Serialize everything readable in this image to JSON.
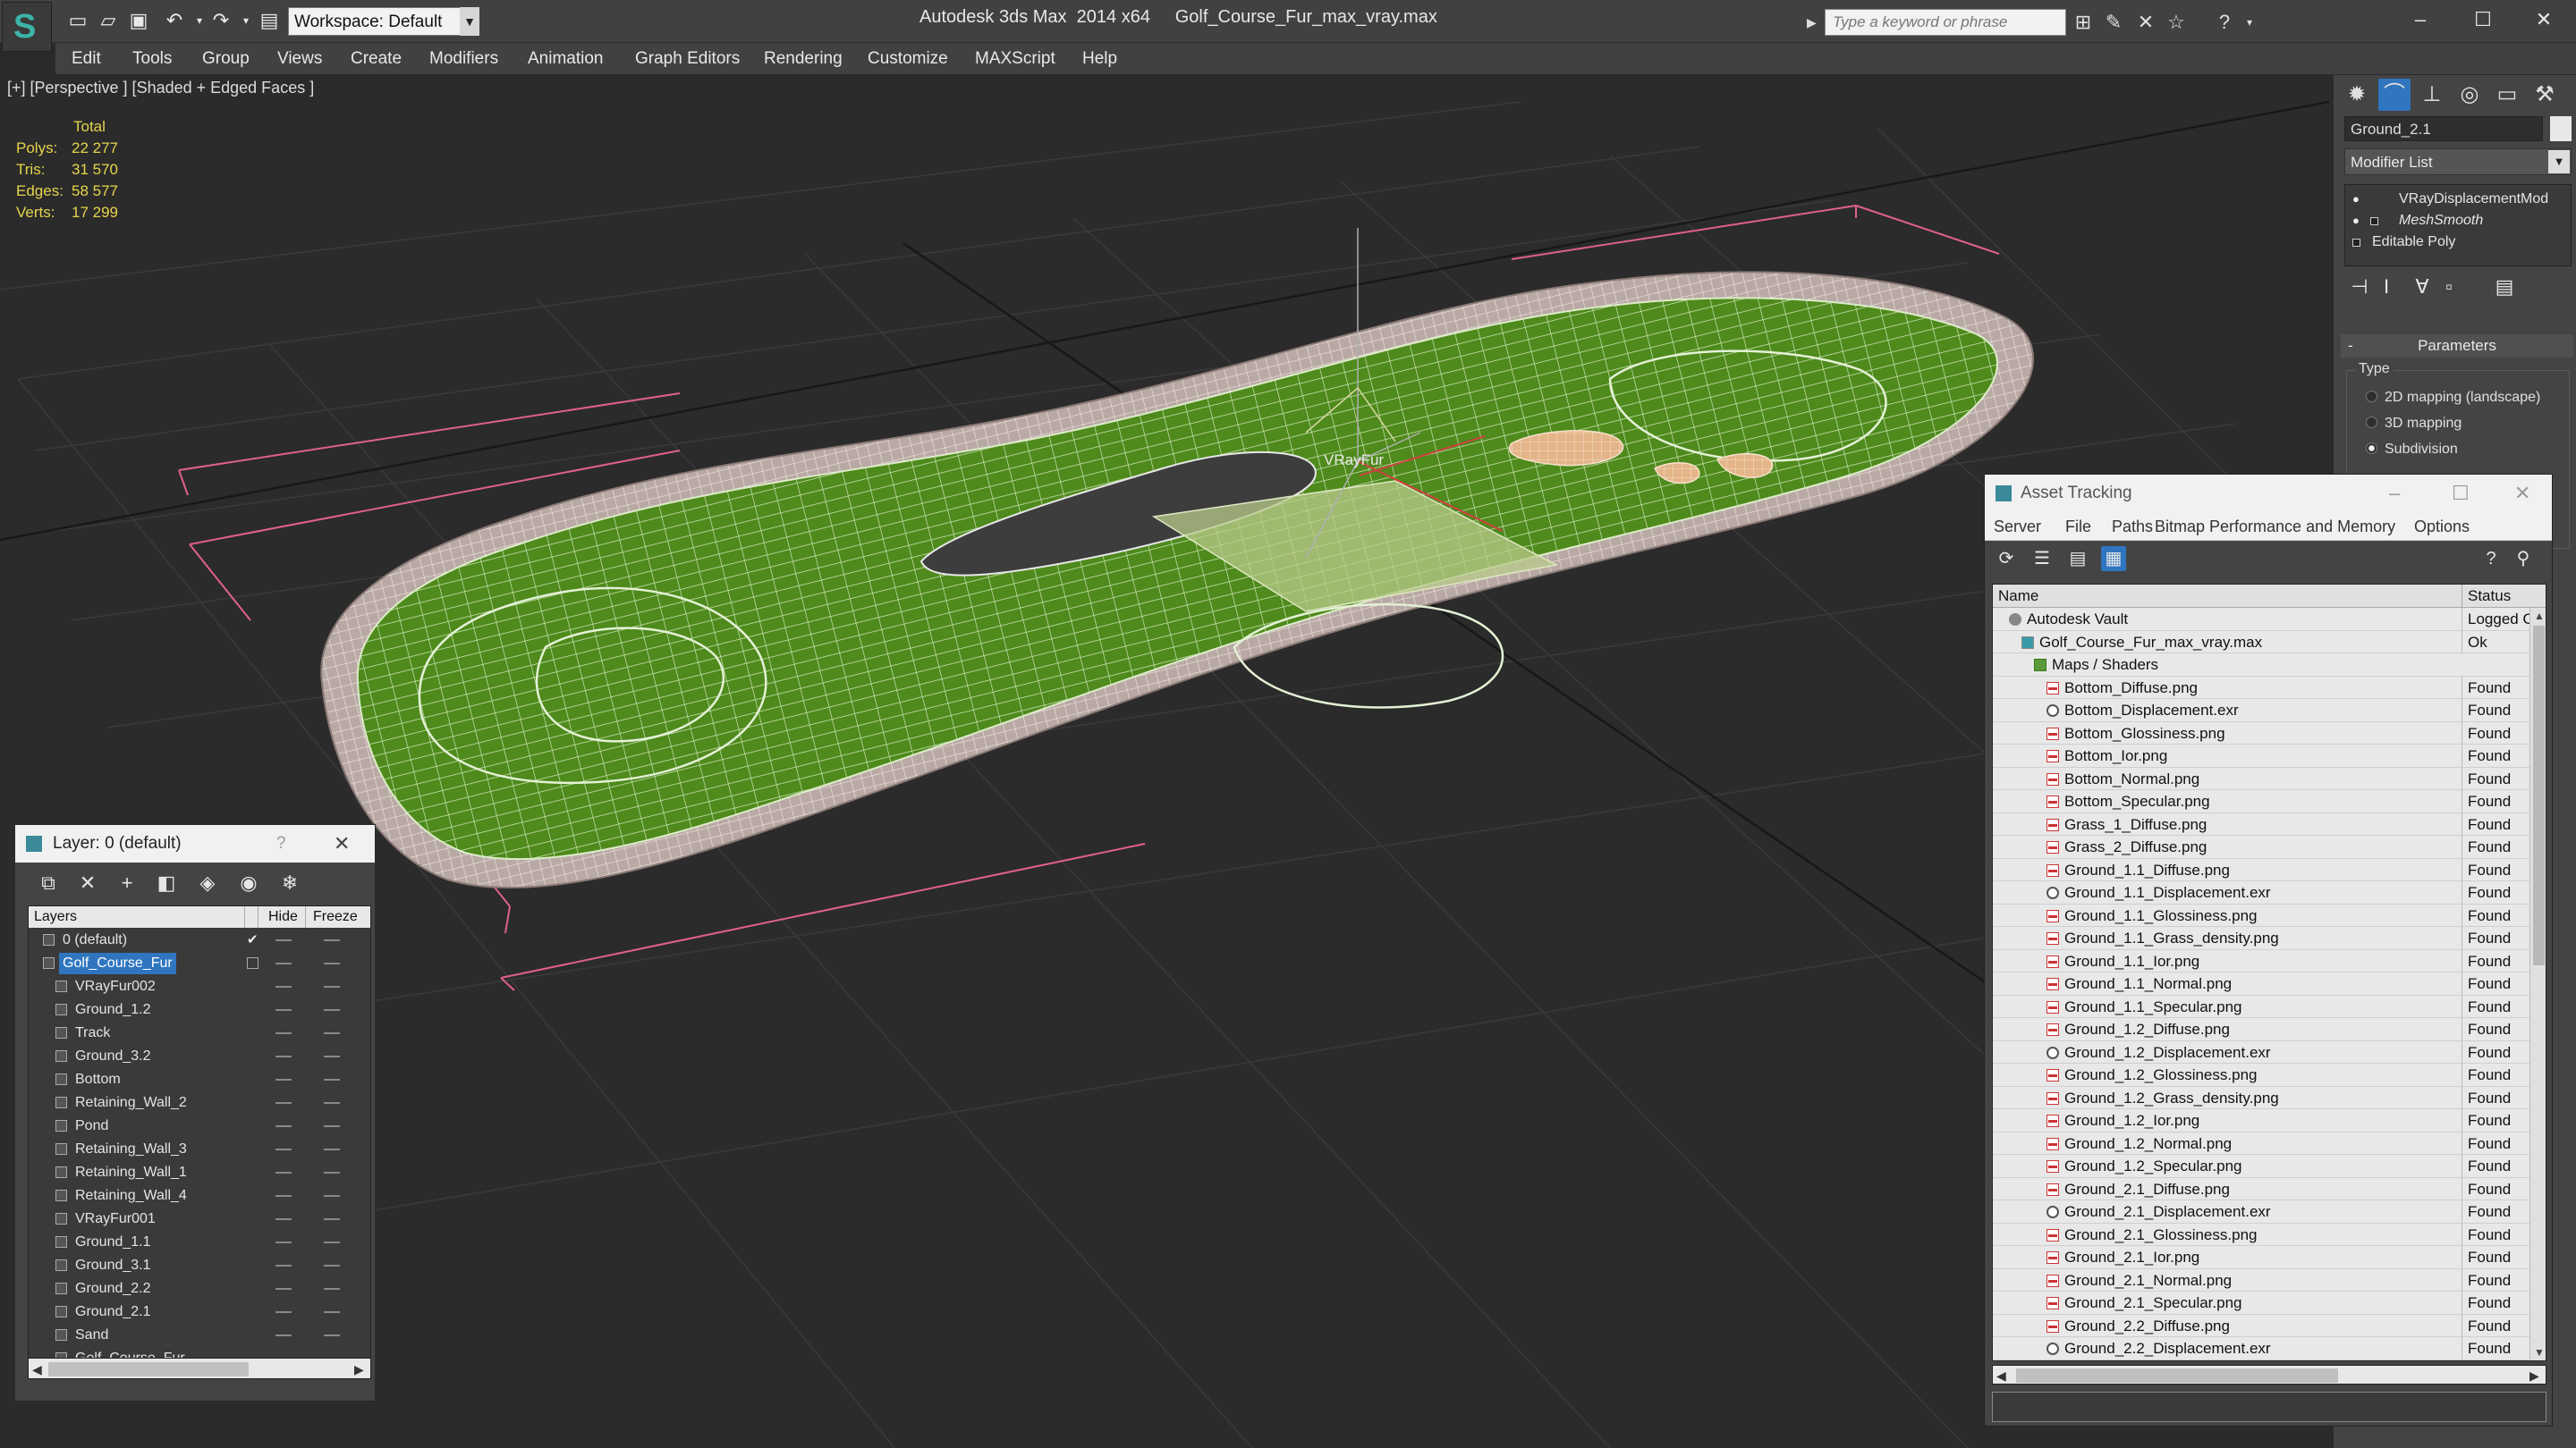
{
  "titlebar": {
    "workspace": "Workspace: Default",
    "app_title": "Autodesk 3ds Max  2014 x64",
    "file_title": "Golf_Course_Fur_max_vray.max",
    "search_placeholder": "Type a keyword or phrase"
  },
  "menu": [
    "Edit",
    "Tools",
    "Group",
    "Views",
    "Create",
    "Modifiers",
    "Animation",
    "Graph Editors",
    "Rendering",
    "Customize",
    "MAXScript",
    "Help"
  ],
  "viewport": {
    "label": "[+] [Perspective ] [Shaded + Edged Faces ]",
    "stats": {
      "header": "Total",
      "rows": [
        {
          "label": "Polys:",
          "value": "22 277"
        },
        {
          "label": "Tris:",
          "value": "31 570"
        },
        {
          "label": "Edges:",
          "value": "58 577"
        },
        {
          "label": "Verts:",
          "value": "17 299"
        }
      ]
    },
    "object_label": "VRayFur"
  },
  "command_panel": {
    "object_name": "Ground_2.1",
    "modifier_list": "Modifier List",
    "stack": [
      "VRayDisplacementMod",
      "MeshSmooth",
      "Editable Poly"
    ],
    "params_title": "Parameters",
    "type_group": "Type",
    "type_options": [
      {
        "label": "2D mapping (landscape)",
        "selected": false
      },
      {
        "label": "3D mapping",
        "selected": false
      },
      {
        "label": "Subdivision",
        "selected": true
      }
    ]
  },
  "layer_window": {
    "title": "Layer: 0 (default)",
    "help": "?",
    "col_layers": "Layers",
    "col_hide": "Hide",
    "col_freeze": "Freeze",
    "rows": [
      {
        "name": "0 (default)",
        "level": 1,
        "current": true,
        "selected": false
      },
      {
        "name": "Golf_Course_Fur",
        "level": 1,
        "current": false,
        "selected": true
      },
      {
        "name": "VRayFur002",
        "level": 2
      },
      {
        "name": "Ground_1.2",
        "level": 2
      },
      {
        "name": "Track",
        "level": 2
      },
      {
        "name": "Ground_3.2",
        "level": 2
      },
      {
        "name": "Bottom",
        "level": 2
      },
      {
        "name": "Retaining_Wall_2",
        "level": 2
      },
      {
        "name": "Pond",
        "level": 2
      },
      {
        "name": "Retaining_Wall_3",
        "level": 2
      },
      {
        "name": "Retaining_Wall_1",
        "level": 2
      },
      {
        "name": "Retaining_Wall_4",
        "level": 2
      },
      {
        "name": "VRayFur001",
        "level": 2
      },
      {
        "name": "Ground_1.1",
        "level": 2
      },
      {
        "name": "Ground_3.1",
        "level": 2
      },
      {
        "name": "Ground_2.2",
        "level": 2
      },
      {
        "name": "Ground_2.1",
        "level": 2
      },
      {
        "name": "Sand",
        "level": 2
      },
      {
        "name": "Golf_Course_Fur",
        "level": 2
      }
    ]
  },
  "asset_window": {
    "title": "Asset Tracking",
    "menu": [
      "Server",
      "File",
      "Paths",
      "Bitmap Performance and Memory",
      "Options"
    ],
    "col_name": "Name",
    "col_status": "Status",
    "rows": [
      {
        "name": "Autodesk Vault",
        "level": 0,
        "kind": "vault",
        "status": "Logged Out"
      },
      {
        "name": "Golf_Course_Fur_max_vray.max",
        "level": 1,
        "kind": "max",
        "status": "Ok"
      },
      {
        "name": "Maps / Shaders",
        "level": 2,
        "kind": "folder",
        "status": ""
      },
      {
        "name": "Bottom_Diffuse.png",
        "level": 3,
        "kind": "png",
        "status": "Found"
      },
      {
        "name": "Bottom_Displacement.exr",
        "level": 3,
        "kind": "exr",
        "status": "Found"
      },
      {
        "name": "Bottom_Glossiness.png",
        "level": 3,
        "kind": "png",
        "status": "Found"
      },
      {
        "name": "Bottom_Ior.png",
        "level": 3,
        "kind": "png",
        "status": "Found"
      },
      {
        "name": "Bottom_Normal.png",
        "level": 3,
        "kind": "png",
        "status": "Found"
      },
      {
        "name": "Bottom_Specular.png",
        "level": 3,
        "kind": "png",
        "status": "Found"
      },
      {
        "name": "Grass_1_Diffuse.png",
        "level": 3,
        "kind": "png",
        "status": "Found"
      },
      {
        "name": "Grass_2_Diffuse.png",
        "level": 3,
        "kind": "png",
        "status": "Found"
      },
      {
        "name": "Ground_1.1_Diffuse.png",
        "level": 3,
        "kind": "png",
        "status": "Found"
      },
      {
        "name": "Ground_1.1_Displacement.exr",
        "level": 3,
        "kind": "exr",
        "status": "Found"
      },
      {
        "name": "Ground_1.1_Glossiness.png",
        "level": 3,
        "kind": "png",
        "status": "Found"
      },
      {
        "name": "Ground_1.1_Grass_density.png",
        "level": 3,
        "kind": "png",
        "status": "Found"
      },
      {
        "name": "Ground_1.1_Ior.png",
        "level": 3,
        "kind": "png",
        "status": "Found"
      },
      {
        "name": "Ground_1.1_Normal.png",
        "level": 3,
        "kind": "png",
        "status": "Found"
      },
      {
        "name": "Ground_1.1_Specular.png",
        "level": 3,
        "kind": "png",
        "status": "Found"
      },
      {
        "name": "Ground_1.2_Diffuse.png",
        "level": 3,
        "kind": "png",
        "status": "Found"
      },
      {
        "name": "Ground_1.2_Displacement.exr",
        "level": 3,
        "kind": "exr",
        "status": "Found"
      },
      {
        "name": "Ground_1.2_Glossiness.png",
        "level": 3,
        "kind": "png",
        "status": "Found"
      },
      {
        "name": "Ground_1.2_Grass_density.png",
        "level": 3,
        "kind": "png",
        "status": "Found"
      },
      {
        "name": "Ground_1.2_Ior.png",
        "level": 3,
        "kind": "png",
        "status": "Found"
      },
      {
        "name": "Ground_1.2_Normal.png",
        "level": 3,
        "kind": "png",
        "status": "Found"
      },
      {
        "name": "Ground_1.2_Specular.png",
        "level": 3,
        "kind": "png",
        "status": "Found"
      },
      {
        "name": "Ground_2.1_Diffuse.png",
        "level": 3,
        "kind": "png",
        "status": "Found"
      },
      {
        "name": "Ground_2.1_Displacement.exr",
        "level": 3,
        "kind": "exr",
        "status": "Found"
      },
      {
        "name": "Ground_2.1_Glossiness.png",
        "level": 3,
        "kind": "png",
        "status": "Found"
      },
      {
        "name": "Ground_2.1_Ior.png",
        "level": 3,
        "kind": "png",
        "status": "Found"
      },
      {
        "name": "Ground_2.1_Normal.png",
        "level": 3,
        "kind": "png",
        "status": "Found"
      },
      {
        "name": "Ground_2.1_Specular.png",
        "level": 3,
        "kind": "png",
        "status": "Found"
      },
      {
        "name": "Ground_2.2_Diffuse.png",
        "level": 3,
        "kind": "png",
        "status": "Found"
      },
      {
        "name": "Ground_2.2_Displacement.exr",
        "level": 3,
        "kind": "exr",
        "status": "Found"
      }
    ]
  },
  "colors": {
    "accent_blue": "#2f75c0",
    "stats_yellow": "#e6d44c",
    "grass_green": "#4f8a1e",
    "sand": "#e8b98a",
    "selection_pink": "#e0608c"
  }
}
